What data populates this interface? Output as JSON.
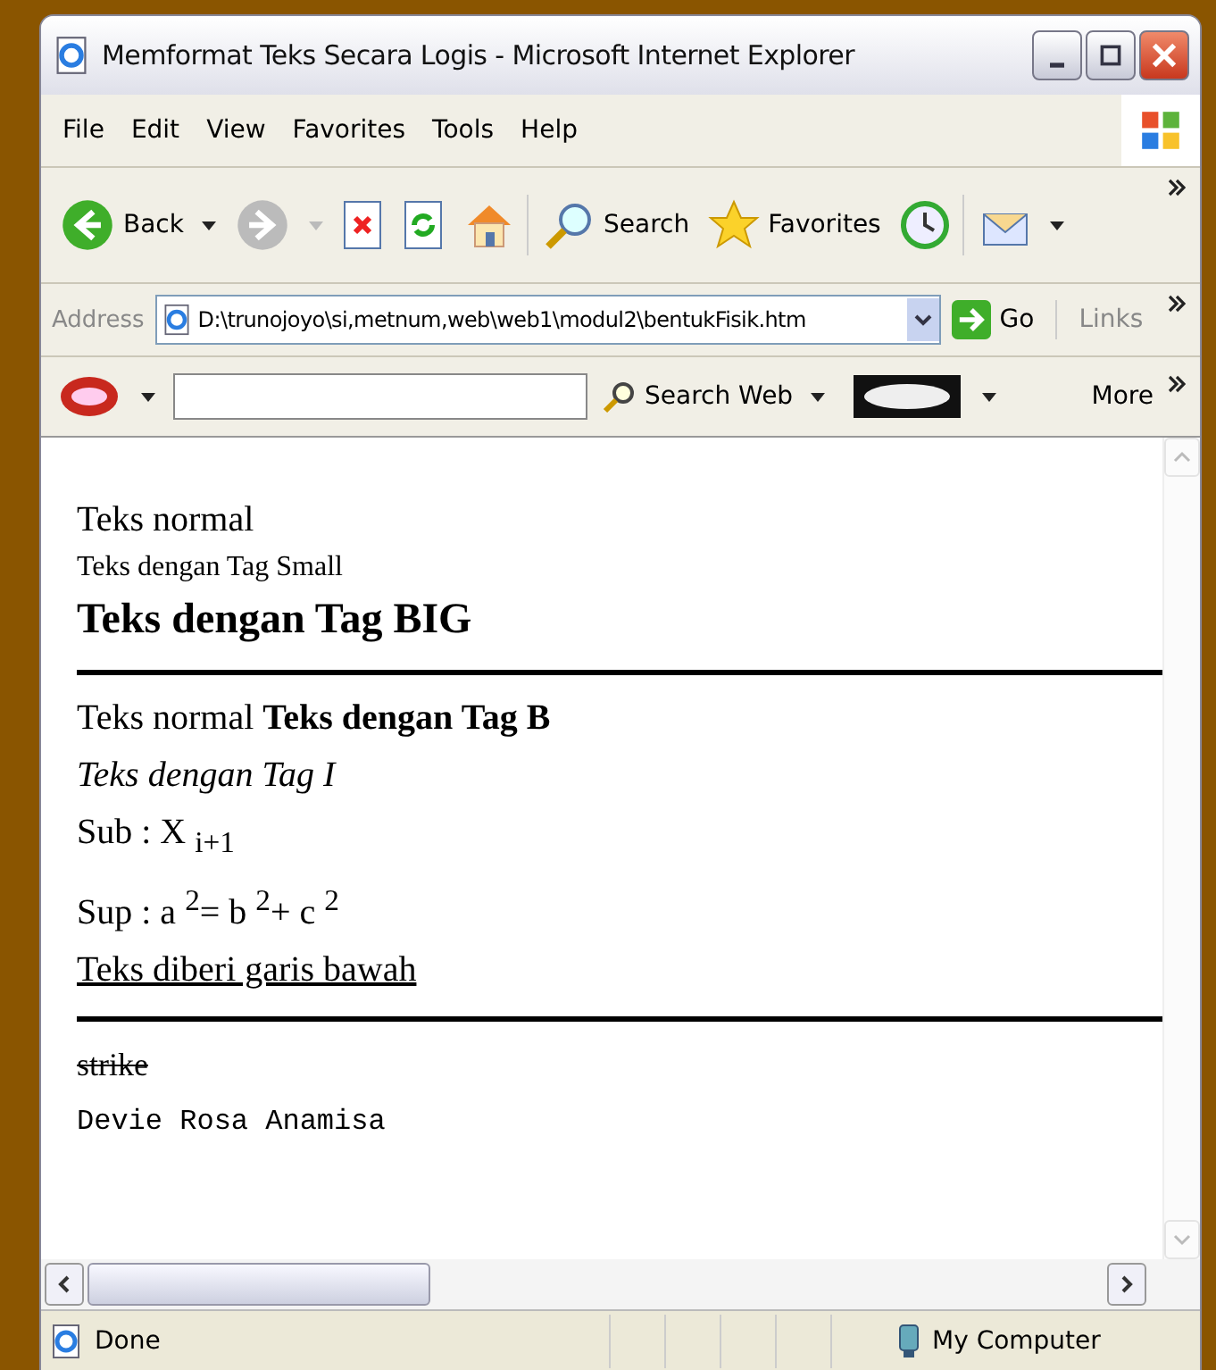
{
  "window": {
    "title": "Memformat Teks Secara Logis - Microsoft Internet Explorer"
  },
  "menu": [
    "File",
    "Edit",
    "View",
    "Favorites",
    "Tools",
    "Help"
  ],
  "toolbar": [
    {
      "kind": "back",
      "label": "Back"
    },
    {
      "kind": "forward"
    },
    {
      "kind": "stop"
    },
    {
      "kind": "refresh"
    },
    {
      "kind": "home"
    },
    {
      "kind": "search",
      "label": "Search"
    },
    {
      "kind": "favorites",
      "label": "Favorites"
    },
    {
      "kind": "history"
    },
    {
      "kind": "mail"
    }
  ],
  "address": {
    "label": "Address",
    "value": "D:\\trunojoyo\\si,metnum,web\\web1\\modul2\\bentukFisik.htm",
    "go": "Go",
    "links": "Links"
  },
  "askbar": {
    "search_label": "Search Web",
    "more": "More"
  },
  "content": [
    {
      "kind": "normal",
      "text": "Teks normal"
    },
    {
      "kind": "small",
      "text": "Teks dengan Tag Small"
    },
    {
      "kind": "big",
      "text": "Teks dengan Tag BIG"
    },
    {
      "kind": "rule"
    },
    {
      "kind": "normal",
      "text": "Teks normal **Teks dengan Tag B**"
    },
    {
      "kind": "italic",
      "text": "Teks dengan Tag I"
    },
    {
      "kind": "normal",
      "text": "Sub : X $_{i+1}$"
    },
    {
      "kind": "normal",
      "text": "Sup : a $^{2}$= b $^{2}$+ c $^{2}$"
    },
    {
      "kind": "underline",
      "text": "Teks diberi garis bawah"
    },
    {
      "kind": "rule"
    },
    {
      "kind": "strike",
      "text": "strike"
    },
    {
      "kind": "mono",
      "text": "Devie Rosa Anamisa"
    }
  ],
  "status_bar": {
    "text": "Done",
    "zone": "My Computer"
  }
}
